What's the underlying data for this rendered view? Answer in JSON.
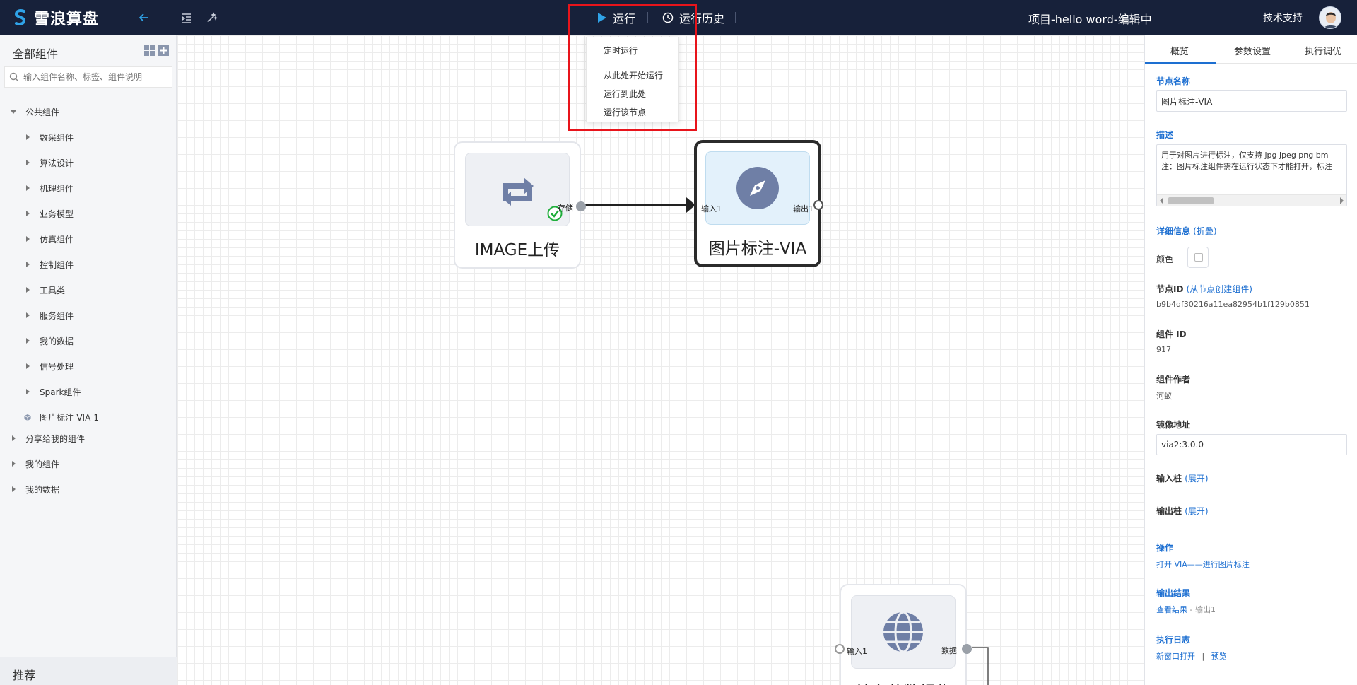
{
  "topbar": {
    "logo_text": "雪浪算盘",
    "run_label": "运行",
    "history_label": "运行历史",
    "project_title": "项目-hello word-编辑中",
    "support_label": "技术支持"
  },
  "run_menu": {
    "items": [
      "定时运行",
      "从此处开始运行",
      "运行到此处",
      "运行该节点"
    ]
  },
  "sidebar": {
    "title": "全部组件",
    "search_placeholder": "输入组件名称、标签、组件说明",
    "root": "公共组件",
    "children": [
      "数采组件",
      "算法设计",
      "机理组件",
      "业务模型",
      "仿真组件",
      "控制组件",
      "工具类",
      "服务组件",
      "我的数据",
      "信号处理",
      "Spark组件"
    ],
    "leaf": "图片标注-VIA-1",
    "sections": [
      "分享给我的组件",
      "我的组件",
      "我的数据"
    ],
    "bottom": "推荐"
  },
  "canvas": {
    "nodes": {
      "upload": {
        "label": "IMAGE上传",
        "port_out": "存储"
      },
      "via": {
        "label": "图片标注-VIA",
        "port_in": "输入1",
        "port_out": "输出1"
      },
      "third": {
        "label": "首字节数报告",
        "port_in": "输入1",
        "port_out": "数据"
      }
    }
  },
  "panel": {
    "tabs": [
      "概览",
      "参数设置",
      "执行调优"
    ],
    "node_name_label": "节点名称",
    "node_name_value": "图片标注-VIA",
    "desc_label": "描述",
    "desc_line1": "用于对图片进行标注，仅支持 jpg jpeg png bm",
    "desc_line2": "注：图片标注组件需在运行状态下才能打开，标注",
    "detail_label": "详细信息",
    "detail_link": "(折叠)",
    "color_label": "颜色",
    "node_id_label": "节点ID",
    "node_id_link": "(从节点创建组件)",
    "node_id_value": "b9b4df30216a11ea82954b1f129b0851",
    "comp_id_label": "组件 ID",
    "comp_id_value": "917",
    "author_label": "组件作者",
    "author_value": "河蚁",
    "image_label": "镜像地址",
    "image_value": "via2:3.0.0",
    "input_label": "输入桩",
    "input_link": "(展开)",
    "output_label": "输出桩",
    "output_link": "(展开)",
    "op_label": "操作",
    "op_link": "打开 VIA——进行图片标注",
    "result_label": "输出结果",
    "result_link": "查看结果",
    "result_suffix": " - 输出1",
    "log_label": "执行日志",
    "log_link1": "新窗口打开",
    "log_sep": "|",
    "log_link2": "预览"
  },
  "colors": {
    "topbar_bg": "#17213a",
    "accent_blue": "#1d6fd1",
    "highlight_red": "#e8141b",
    "success_green": "#1fae3b",
    "icon_slate": "#6f7fa6"
  }
}
